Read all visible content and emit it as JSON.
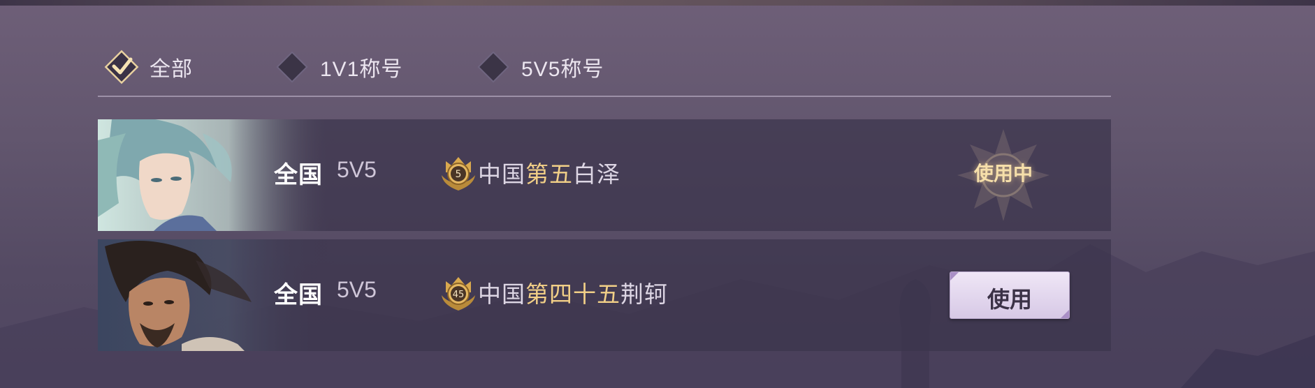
{
  "filters": [
    {
      "label": "全部",
      "selected": true,
      "icon": "diamond-check-icon"
    },
    {
      "label": "1V1称号",
      "selected": false,
      "icon": "diamond-icon"
    },
    {
      "label": "5V5称号",
      "selected": false,
      "icon": "diamond-icon"
    }
  ],
  "rows": [
    {
      "portrait": "hero-portrait-baize",
      "scope": "全国",
      "mode": "5V5",
      "rank": "5",
      "title_prefix": "中国",
      "title_highlight": "第五",
      "title_suffix": "白泽",
      "status_label": "使用中",
      "status": "in-use"
    },
    {
      "portrait": "hero-portrait-jingke",
      "scope": "全国",
      "mode": "5V5",
      "rank": "45",
      "title_prefix": "中国",
      "title_highlight": "第四十五",
      "title_suffix": "荆轲",
      "status_label": "使用",
      "status": "available"
    }
  ],
  "colors": {
    "accent_gold": "#f1cf87",
    "button_bg": "#e6dcef",
    "row_bg": "#3c344c"
  }
}
